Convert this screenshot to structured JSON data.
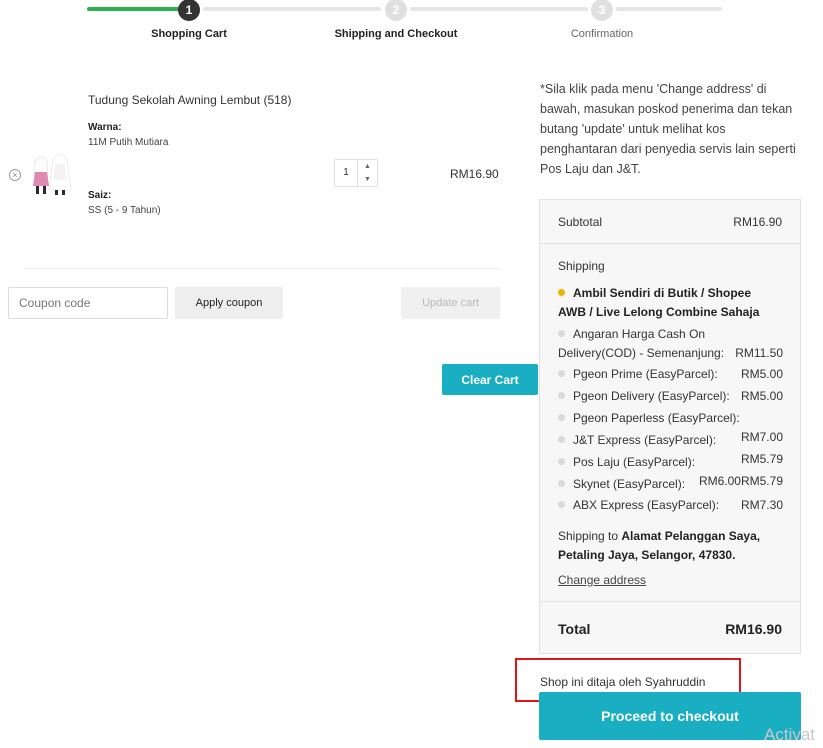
{
  "steps": [
    {
      "number": "1",
      "label": "Shopping Cart"
    },
    {
      "number": "2",
      "label": "Shipping and Checkout"
    },
    {
      "number": "3",
      "label": "Confirmation"
    }
  ],
  "cart_item": {
    "title": "Tudung Sekolah Awning Lembut (518)",
    "attr1_label": "Warna:",
    "attr1_value": "11M Putih Mutiara",
    "attr2_label": "Saiz:",
    "attr2_value": "SS (5 - 9 Tahun)",
    "quantity": "1",
    "price": "RM16.90"
  },
  "coupon": {
    "placeholder": "Coupon code",
    "apply_label": "Apply coupon",
    "update_label": "Update cart",
    "clear_label": "Clear Cart"
  },
  "note": "*Sila klik pada menu 'Change address' di bawah, masukan poskod penerima dan tekan butang 'update' untuk melihat kos penghantaran dari penyedia servis lain seperti Pos Laju dan J&T.",
  "totals": {
    "subtotal_label": "Subtotal",
    "subtotal_value": "RM16.90",
    "shipping_label": "Shipping",
    "option_selected_line1": "Ambil Sendiri di Butik / Shopee",
    "option_selected_line2": "AWB / Live Lelong Combine Sahaja",
    "cod_line1": "Angaran Harga Cash On",
    "cod_line2": "Delivery(COD) - Semenanjung:",
    "cod_price": "RM11.50",
    "options": [
      {
        "label": "Pgeon Prime (EasyParcel):",
        "price": "RM5.00"
      },
      {
        "label": "Pgeon Delivery (EasyParcel):",
        "price": "RM5.00"
      },
      {
        "label": "Pgeon Paperless (EasyParcel):",
        "price": ""
      },
      {
        "label": "J&T Express (EasyParcel):",
        "price": "RM7.00"
      },
      {
        "label": "Pos Laju (EasyParcel):",
        "price": "RM5.79"
      },
      {
        "label": "Skynet (EasyParcel):",
        "price": "RM6.00RM5.79"
      },
      {
        "label": "ABX Express (EasyParcel):",
        "price": "RM7.30"
      }
    ],
    "shipping_to_prefix": "Shipping to ",
    "address_line1": "Alamat Pelanggan Saya,",
    "address_line2": "Petaling Jaya, Selangor, 47830",
    "address_suffix": ".",
    "change_address": "Change address",
    "total_label": "Total",
    "total_value": "RM16.90"
  },
  "sponsor_text": "Shop ini ditaja oleh Syahruddin",
  "checkout_label": "Proceed to checkout",
  "watermark": "Activat",
  "colors": {
    "accent": "#1aaec2",
    "progress": "#2db04b",
    "highlight_border": "#e0141b",
    "selected_radio": "#f0b400"
  }
}
